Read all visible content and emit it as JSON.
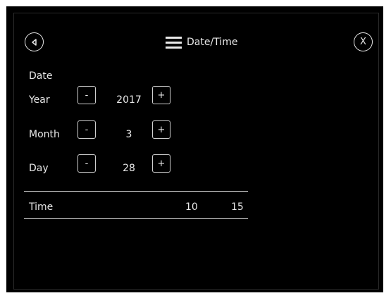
{
  "header": {
    "title": "Date/Time",
    "back_icon": "back-triangle-icon",
    "menu_icon": "hamburger-menu-icon",
    "close_label": "X"
  },
  "date_section": {
    "label": "Date",
    "rows": [
      {
        "label": "Year",
        "minus": "-",
        "value": "2017",
        "plus": "+"
      },
      {
        "label": "Month",
        "minus": "-",
        "value": "3",
        "plus": "+"
      },
      {
        "label": "Day",
        "minus": "-",
        "value": "28",
        "plus": "+"
      }
    ]
  },
  "time_row": {
    "label": "Time",
    "hour": "10",
    "minute": "15"
  }
}
